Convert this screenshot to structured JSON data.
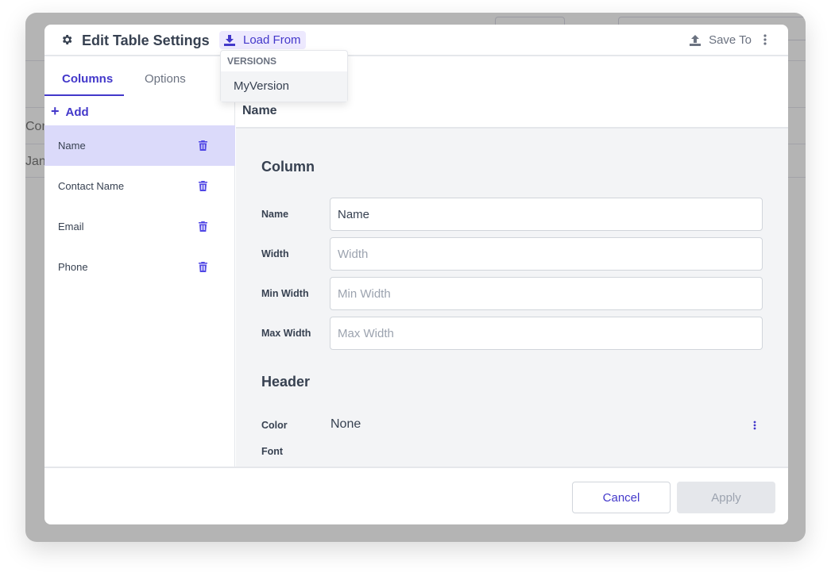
{
  "background": {
    "row_texts": [
      "Cor",
      "Jan"
    ]
  },
  "header": {
    "title": "Edit Table Settings",
    "load_from": "Load From",
    "save_to": "Save To"
  },
  "dropdown": {
    "section": "VERSIONS",
    "items": [
      "MyVersion"
    ]
  },
  "tabs": [
    {
      "label": "Columns",
      "active": true
    },
    {
      "label": "Options",
      "active": false
    }
  ],
  "add_label": "Add",
  "columns": [
    {
      "label": "Name",
      "selected": true
    },
    {
      "label": "Contact Name"
    },
    {
      "label": "Email"
    },
    {
      "label": "Phone"
    }
  ],
  "detail": {
    "title": "Name",
    "column_section": "Column",
    "fields": [
      {
        "label": "Name",
        "value": "Name",
        "placeholder": "Name"
      },
      {
        "label": "Width",
        "value": "",
        "placeholder": "Width"
      },
      {
        "label": "Min Width",
        "value": "",
        "placeholder": "Min Width"
      },
      {
        "label": "Max Width",
        "value": "",
        "placeholder": "Max Width"
      }
    ],
    "header_section": "Header",
    "color_label": "Color",
    "color_value": "None",
    "font_label": "Font"
  },
  "footer": {
    "cancel": "Cancel",
    "apply": "Apply"
  },
  "colors": {
    "accent": "#4338ca",
    "selected_bg": "#dbdafa",
    "apply_bg": "#e5e7eb"
  }
}
